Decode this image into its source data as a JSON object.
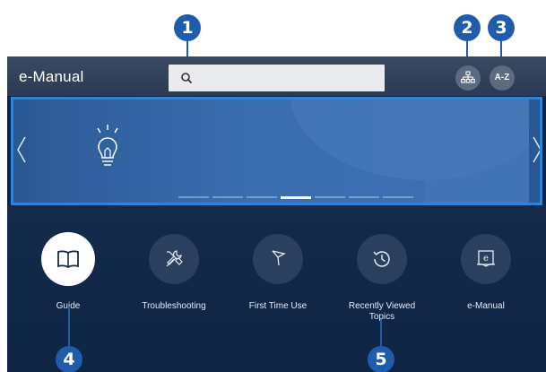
{
  "callouts": [
    "1",
    "2",
    "3",
    "4",
    "5"
  ],
  "header": {
    "title": "e-Manual",
    "search_placeholder": "",
    "az_label": "A-Z"
  },
  "banner": {
    "slide_count": 7,
    "active_slide": 4
  },
  "menu": [
    {
      "label": "Guide",
      "icon": "book-icon",
      "selected": true
    },
    {
      "label": "Troubleshooting",
      "icon": "tools-icon",
      "selected": false
    },
    {
      "label": "First Time Use",
      "icon": "flag-icon",
      "selected": false
    },
    {
      "label": "Recently Viewed\nTopics",
      "icon": "history-icon",
      "selected": false
    },
    {
      "label": "e-Manual",
      "icon": "emanual-book-icon",
      "selected": false
    }
  ],
  "colors": {
    "callout": "#1f5cab",
    "banner_border": "#2f83d6",
    "background": "#0f2544"
  }
}
